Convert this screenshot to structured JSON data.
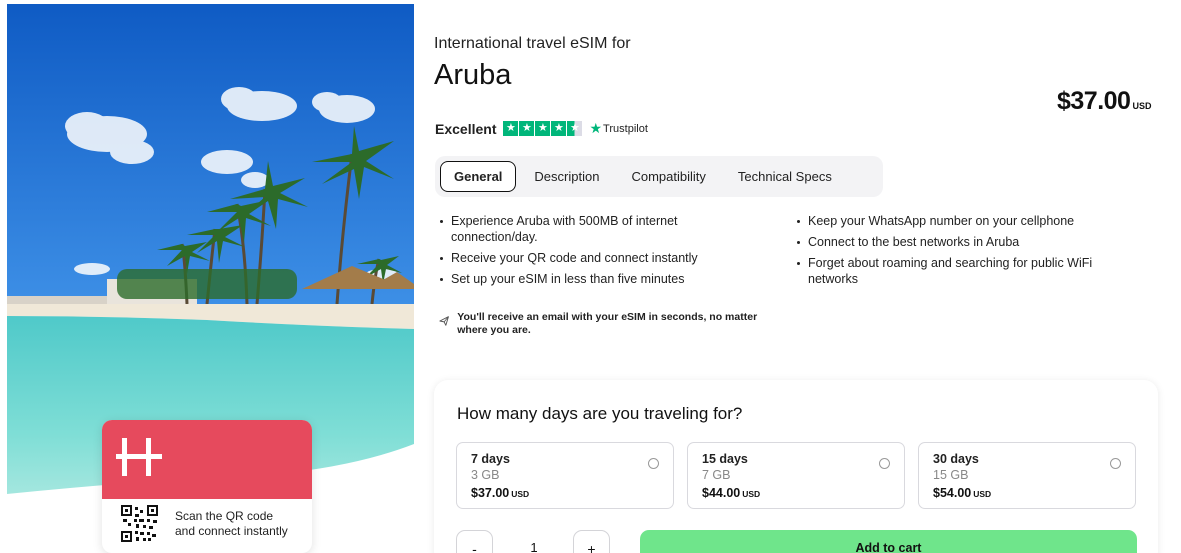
{
  "hero": {
    "card_text": "Scan the QR code and connect instantly",
    "card_color": "#e64a5d"
  },
  "product": {
    "subtitle": "International travel eSIM for",
    "title": "Aruba",
    "price": "$37.00",
    "currency": "USD"
  },
  "rating": {
    "label": "Excellent",
    "stars": 4.5,
    "provider": "Trustpilot"
  },
  "tabs": [
    {
      "label": "General",
      "active": true
    },
    {
      "label": "Description",
      "active": false
    },
    {
      "label": "Compatibility",
      "active": false
    },
    {
      "label": "Technical Specs",
      "active": false
    }
  ],
  "features_left": [
    "Experience Aruba with 500MB of internet connection/day.",
    "Receive your QR code and connect instantly",
    "Set up your eSIM in less than five minutes"
  ],
  "features_right": [
    "Keep your WhatsApp number on your cellphone",
    "Connect to the best networks in Aruba",
    "Forget about roaming and searching for public WiFi networks"
  ],
  "notice": "You'll receive an email with your eSIM in seconds, no matter where you are.",
  "days": {
    "question": "How many days are you traveling for?",
    "plans": [
      {
        "days": "7 days",
        "data": "3 GB",
        "price": "$37.00",
        "currency": "USD"
      },
      {
        "days": "15 days",
        "data": "7 GB",
        "price": "$44.00",
        "currency": "USD"
      },
      {
        "days": "30 days",
        "data": "15 GB",
        "price": "$54.00",
        "currency": "USD"
      }
    ]
  },
  "cart": {
    "minus": "-",
    "quantity": "1",
    "plus": "+",
    "add_label": "Add to cart",
    "button_color": "#6fe58b"
  },
  "colors": {
    "trustpilot_green": "#00b67a",
    "brand_red": "#e64a5d",
    "cta_green": "#6fe58b"
  }
}
